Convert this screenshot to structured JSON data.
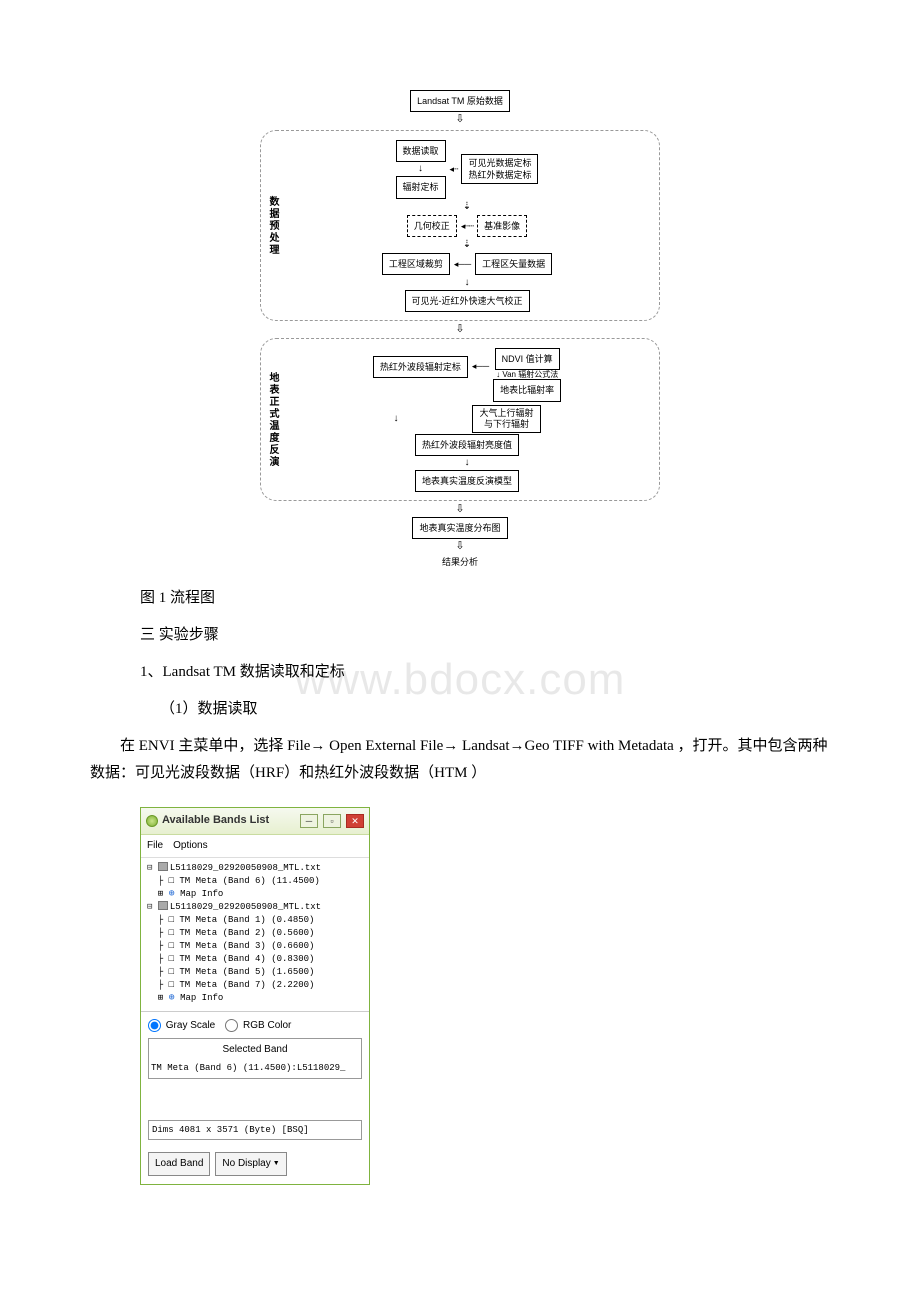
{
  "watermark": "www.bdocx.com",
  "flowchart": {
    "top": "Landsat TM 原始数据",
    "group1_label": "数据预处理",
    "g1_read": "数据读取",
    "g1_calib": "辐射定标",
    "g1_side1a": "可见光数据定标",
    "g1_side1b": "热红外数据定标",
    "g1_geo": "几何校正",
    "g1_baseimg": "基准影像",
    "g1_crop": "工程区域裁剪",
    "g1_vector": "工程区矢量数据",
    "g1_atmo": "可见光-近红外快速大气校正",
    "group2_label": "地表正式温度反演",
    "g2_ndvi": "NDVI 值计算",
    "g2_calib": "热红外波段辐射定标",
    "g2_van": "Van 辐射公式法",
    "g2_emiss": "地表比辐射率",
    "g2_updown": "大气上行辐射\n与下行辐射",
    "g2_high": "热红外波段辐射亮度值",
    "g2_model": "地表真实温度反演模型",
    "bottom1": "地表真实温度分布图",
    "bottom2": "结果分析"
  },
  "text": {
    "caption": "图 1 流程图",
    "sec3": "三 实验步骤",
    "h1": "1、Landsat TM 数据读取和定标",
    "h1_1": "（1）数据读取",
    "para1": "在 ENVI 主菜单中，选择 File→ Open External File→ Landsat→Geo TIFF with Metadata ，打开。其中包含两种数据：可见光波段数据（HRF）和热红外波段数据（HTM ）"
  },
  "envi": {
    "title": "Available Bands List",
    "menu_file": "File",
    "menu_options": "Options",
    "file1": "L5118029_02920050908_MTL.txt",
    "file2": "L5118029_02920050908_MTL.txt",
    "band6": "TM Meta (Band 6) (11.4500)",
    "band1": "TM Meta (Band 1) (0.4850)",
    "band2": "TM Meta (Band 2) (0.5600)",
    "band3": "TM Meta (Band 3) (0.6600)",
    "band4": "TM Meta (Band 4) (0.8300)",
    "band5": "TM Meta (Band 5) (1.6500)",
    "band7": "TM Meta (Band 7) (2.2200)",
    "mapinfo": "Map Info",
    "gray": "Gray Scale",
    "rgb": "RGB Color",
    "selected_title": "Selected Band",
    "selected_band": "TM Meta (Band 6) (11.4500):L5118029_",
    "dims": "Dims 4081 x 3571 (Byte) [BSQ]",
    "load": "Load Band",
    "nodisplay": "No Display"
  }
}
